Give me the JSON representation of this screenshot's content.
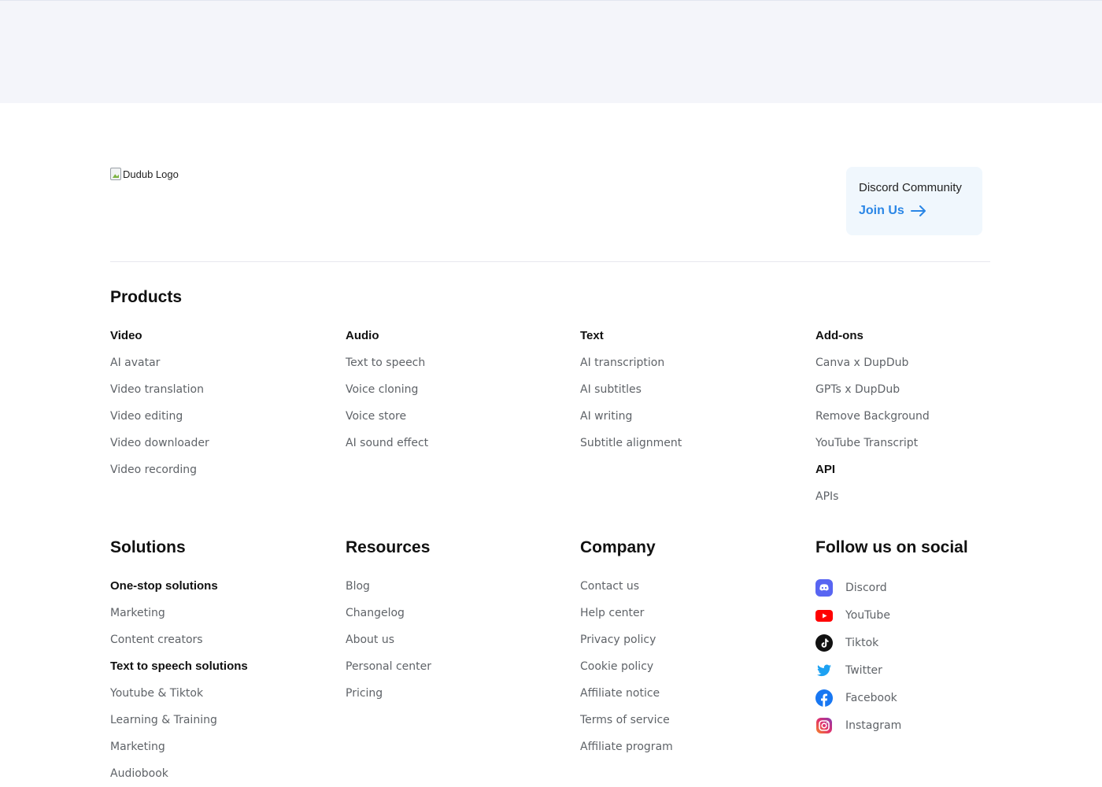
{
  "logo": {
    "alt": "Dudub Logo"
  },
  "discord_card": {
    "title": "Discord Community",
    "join_label": "Join Us"
  },
  "products": {
    "title": "Products",
    "columns": [
      {
        "items": [
          {
            "label": "Video",
            "head": true
          },
          {
            "label": "AI avatar"
          },
          {
            "label": "Video translation"
          },
          {
            "label": "Video editing"
          },
          {
            "label": "Video downloader"
          },
          {
            "label": "Video recording"
          }
        ]
      },
      {
        "items": [
          {
            "label": "Audio",
            "head": true
          },
          {
            "label": "Text to speech"
          },
          {
            "label": "Voice cloning"
          },
          {
            "label": "Voice store"
          },
          {
            "label": "AI sound effect"
          }
        ]
      },
      {
        "items": [
          {
            "label": "Text",
            "head": true
          },
          {
            "label": "AI transcription"
          },
          {
            "label": "AI subtitles"
          },
          {
            "label": "AI writing"
          },
          {
            "label": "Subtitle alignment"
          }
        ]
      },
      {
        "items": [
          {
            "label": "Add-ons",
            "head": true
          },
          {
            "label": "Canva x DupDub"
          },
          {
            "label": "GPTs x DupDub"
          },
          {
            "label": "Remove Background"
          },
          {
            "label": "YouTube Transcript"
          },
          {
            "label": "API",
            "head": true
          },
          {
            "label": "APIs"
          }
        ]
      }
    ]
  },
  "solutions": {
    "title": "Solutions",
    "items": [
      {
        "label": "One-stop solutions",
        "head": true
      },
      {
        "label": "Marketing"
      },
      {
        "label": "Content creators"
      },
      {
        "label": "Text to speech solutions",
        "head": true
      },
      {
        "label": "Youtube & Tiktok"
      },
      {
        "label": "Learning & Training"
      },
      {
        "label": "Marketing"
      },
      {
        "label": "Audiobook"
      }
    ]
  },
  "resources": {
    "title": "Resources",
    "items": [
      {
        "label": "Blog"
      },
      {
        "label": "Changelog"
      },
      {
        "label": "About us"
      },
      {
        "label": "Personal center"
      },
      {
        "label": "Pricing"
      }
    ]
  },
  "company": {
    "title": "Company",
    "items": [
      {
        "label": "Contact us"
      },
      {
        "label": "Help center"
      },
      {
        "label": "Privacy policy"
      },
      {
        "label": "Cookie policy"
      },
      {
        "label": "Affiliate notice"
      },
      {
        "label": "Terms of service"
      },
      {
        "label": "Affiliate program"
      }
    ]
  },
  "social": {
    "title": "Follow us on social",
    "items": [
      {
        "label": "Discord",
        "icon": "discord-icon",
        "color": "#5865F2"
      },
      {
        "label": "YouTube",
        "icon": "youtube-icon",
        "color": "#FF0000"
      },
      {
        "label": "Tiktok",
        "icon": "tiktok-icon",
        "color": "#111111"
      },
      {
        "label": "Twitter",
        "icon": "twitter-icon",
        "color": "#1DA1F2"
      },
      {
        "label": "Facebook",
        "icon": "facebook-icon",
        "color": "#1877F2"
      },
      {
        "label": "Instagram",
        "icon": "instagram-icon",
        "color": "#E1306C"
      }
    ]
  },
  "colors": {
    "accent": "#2a86e6",
    "top_band": "#f4f5fa",
    "card_bg": "#f0f7fd"
  }
}
